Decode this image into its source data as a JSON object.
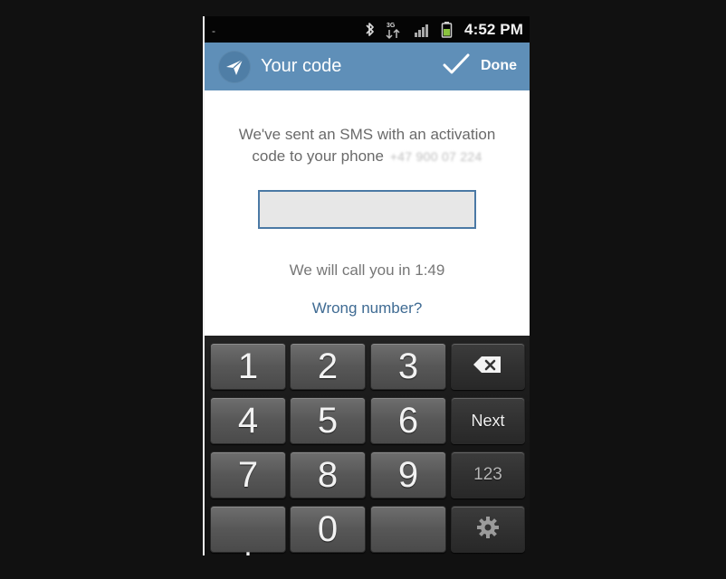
{
  "status_bar": {
    "left_mark": "-",
    "network_label": "3G",
    "time": "4:52 PM",
    "icons": [
      "bluetooth-icon",
      "mobile-data-icon",
      "signal-icon",
      "battery-icon"
    ]
  },
  "action_bar": {
    "title": "Your code",
    "done_label": "Done",
    "app_icon": "paper-plane-icon",
    "done_icon": "check-icon"
  },
  "content": {
    "sms_message": "We've sent an SMS with an activation code to your phone",
    "masked_phone": "+47 900 07 224",
    "code_input_value": "",
    "code_input_placeholder": "",
    "call_text": "We will call you in 1:49",
    "wrong_number": "Wrong number?"
  },
  "keyboard": {
    "keys": {
      "one": "1",
      "two": "2",
      "three": "3",
      "backspace": "backspace-icon",
      "four": "4",
      "five": "5",
      "six": "6",
      "next": "Next",
      "seven": "7",
      "eight": "8",
      "nine": "9",
      "mode": "123",
      "dot": ".",
      "zero": "0",
      "blank": "",
      "settings": "gear-icon"
    }
  },
  "colors": {
    "action_bar": "#5f8fb8",
    "link": "#3f6b93",
    "input_border": "#4b79a5",
    "battery": "#8ac33f"
  }
}
